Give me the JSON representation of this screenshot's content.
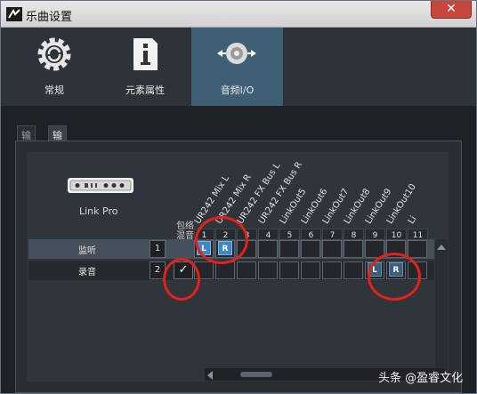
{
  "window": {
    "title": "乐曲设置",
    "close_glyph": "✕"
  },
  "toolbar": [
    {
      "label": "常规",
      "icon": "gear-refresh-icon"
    },
    {
      "label": "元素属性",
      "icon": "document-info-icon"
    },
    {
      "label": "音频I/O",
      "icon": "speaker-io-icon"
    }
  ],
  "tabs": [
    "输入",
    "输出"
  ],
  "device": {
    "name": "Link Pro",
    "icon": "audio-interface-icon"
  },
  "mix_label": "包络\n混音",
  "channels": [
    "UR242 Mix L",
    "UR242 Mix R",
    "UR242 FX Bus L",
    "UR242 FX Bus R",
    "LinkOut5",
    "LinkOut6",
    "LinkOut7",
    "LinkOut8",
    "LinkOut9",
    "LinkOut10",
    "Li"
  ],
  "channel_numbers": [
    "1",
    "2",
    "3",
    "4",
    "5",
    "6",
    "7",
    "8",
    "9",
    "10",
    "11"
  ],
  "rows": [
    {
      "name": "监听",
      "number": "1",
      "checked": false,
      "assign": [
        {
          "col": 1,
          "text": "L"
        },
        {
          "col": 2,
          "text": "R"
        }
      ]
    },
    {
      "name": "录音",
      "number": "2",
      "checked": true,
      "assign": [
        {
          "col": 9,
          "text": "L"
        },
        {
          "col": 10,
          "text": "R"
        }
      ]
    }
  ],
  "check_glyph": "✓",
  "watermark": "头条 @盈睿文化",
  "colors": {
    "active_tab": "#3f5f77",
    "assign": "#3e88c4",
    "highlight_ring": "#e0221b"
  }
}
